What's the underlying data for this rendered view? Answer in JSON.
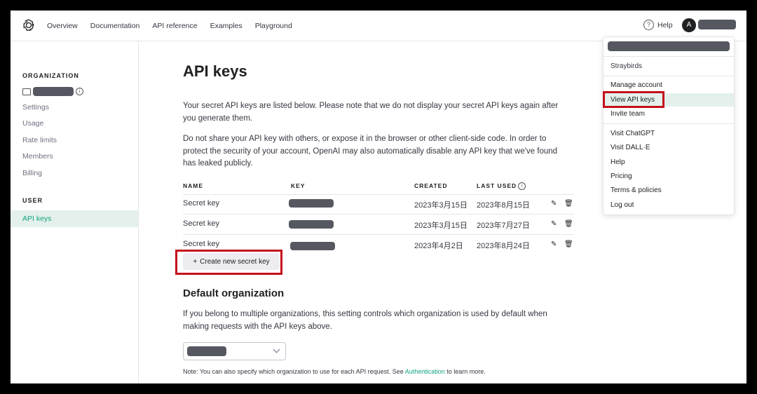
{
  "nav": {
    "links": [
      "Overview",
      "Documentation",
      "API reference",
      "Examples",
      "Playground"
    ],
    "help_label": "Help",
    "avatar_letter": "A"
  },
  "sidebar": {
    "org_heading": "ORGANIZATION",
    "org_items": [
      "Settings",
      "Usage",
      "Rate limits",
      "Members",
      "Billing"
    ],
    "user_heading": "USER",
    "active_item": "API keys"
  },
  "main": {
    "title": "API keys",
    "para1": "Your secret API keys are listed below. Please note that we do not display your secret API keys again after you generate them.",
    "para2": "Do not share your API key with others, or expose it in the browser or other client-side code. In order to protect the security of your account, OpenAI may also automatically disable any API key that we've found has leaked publicly.",
    "table": {
      "headers": [
        "NAME",
        "KEY",
        "CREATED",
        "LAST USED"
      ],
      "rows": [
        {
          "name": "Secret key",
          "created": "2023年3月15日",
          "last_used": "2023年8月15日"
        },
        {
          "name": "Secret key",
          "created": "2023年3月15日",
          "last_used": "2023年7月27日"
        },
        {
          "name": "Secret key",
          "created": "2023年4月2日",
          "last_used": "2023年8月24日"
        }
      ]
    },
    "create_button": "Create new secret key",
    "default_org_title": "Default organization",
    "default_org_text": "If you belong to multiple organizations, this setting controls which organization is used by default when making requests with the API keys above.",
    "note_prefix": "Note: You can also specify which organization to use for each API request. See ",
    "note_link": "Authentication",
    "note_suffix": " to learn more."
  },
  "dropdown": {
    "org_name": "Straybirds",
    "items_group1": [
      "Manage account",
      "View API keys",
      "Invite team"
    ],
    "items_group2": [
      "Visit ChatGPT",
      "Visit DALL·E",
      "Help",
      "Pricing",
      "Terms & policies",
      "Log out"
    ]
  },
  "colors": {
    "accent": "#10a37f",
    "highlight": "#c40f1c",
    "active_bg": "#e3f0ec"
  }
}
